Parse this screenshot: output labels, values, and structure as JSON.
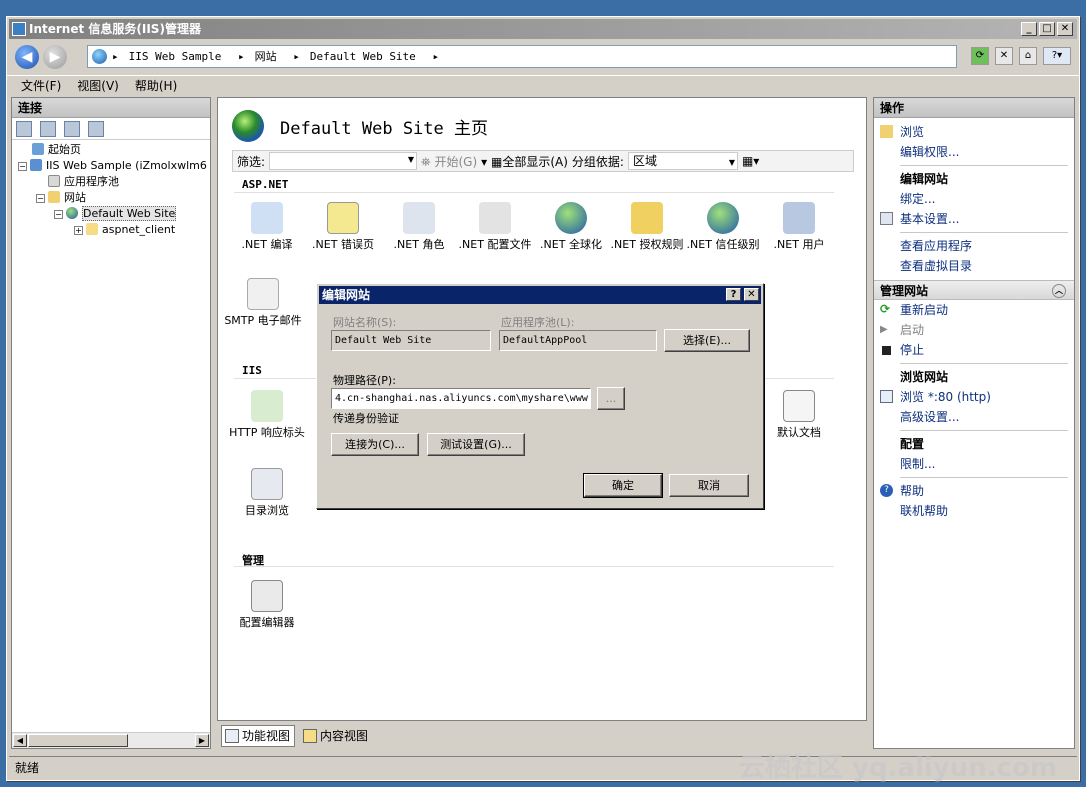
{
  "window": {
    "title": "Internet 信息服务(IIS)管理器",
    "min": "_",
    "max": "□",
    "close": "✕"
  },
  "address": {
    "segments": [
      "IIS Web Sample",
      "网站",
      "Default Web Site"
    ]
  },
  "menu": [
    "文件(F)",
    "视图(V)",
    "帮助(H)"
  ],
  "connections": {
    "title": "连接",
    "tree": [
      {
        "label": "起始页",
        "level": 0
      },
      {
        "label": "IIS Web Sample (iZmolxwlm6",
        "level": 0
      },
      {
        "label": "应用程序池",
        "level": 1
      },
      {
        "label": "网站",
        "level": 1
      },
      {
        "label": "Default Web Site",
        "level": 2
      },
      {
        "label": "aspnet_client",
        "level": 3
      }
    ]
  },
  "main": {
    "title": "Default Web Site 主页",
    "filter_label": "筛选:",
    "go_label": "开始(G)",
    "showall_label": "全部显示(A)",
    "groupby_label": "分组依据:",
    "groupby_value": "区域",
    "groups": {
      "aspnet": "ASP.NET",
      "iis": "IIS",
      "manage": "管理"
    },
    "aspnet_features": [
      ".NET 编译",
      ".NET 错误页",
      ".NET 角色",
      ".NET 配置文件",
      ".NET 全球化",
      ".NET 授权规则",
      ".NET 信任级别",
      ".NET 用户"
    ],
    "row2_features": [
      "SMTP 电子邮件"
    ],
    "iis_features": [
      "HTTP 响应标头",
      "默认文档",
      "目录浏览"
    ],
    "manage_features": [
      "配置编辑器"
    ]
  },
  "tabs": {
    "features": "功能视图",
    "content": "内容视图"
  },
  "actions": {
    "title": "操作",
    "browse": "浏览",
    "edit_perms": "编辑权限...",
    "edit_site_h": "编辑网站",
    "bindings": "绑定...",
    "basic_settings": "基本设置...",
    "view_apps": "查看应用程序",
    "view_vdirs": "查看虚拟目录",
    "manage_site": "管理网站",
    "restart": "重新启动",
    "start": "启动",
    "stop": "停止",
    "browse_site_h": "浏览网站",
    "browse_80": "浏览 *:80 (http)",
    "advanced": "高级设置...",
    "config_h": "配置",
    "limits": "限制...",
    "help": "帮助",
    "online_help": "联机帮助"
  },
  "status": {
    "text": "就绪",
    "watermark": "云栖社区 yq.aliyun.com"
  },
  "dialog": {
    "title": "编辑网站",
    "help_btn": "?",
    "close_btn": "✕",
    "site_name_label": "网站名称(S):",
    "site_name": "Default Web Site",
    "app_pool_label": "应用程序池(L):",
    "app_pool": "DefaultAppPool",
    "select_btn": "选择(E)...",
    "physical_path_label": "物理路径(P):",
    "physical_path": "4.cn-shanghai.nas.aliyuncs.com\\myshare\\www",
    "browse_btn": "...",
    "passthrough_label": "传递身份验证",
    "connect_as_btn": "连接为(C)...",
    "test_btn": "测试设置(G)...",
    "ok_btn": "确定",
    "cancel_btn": "取消"
  }
}
